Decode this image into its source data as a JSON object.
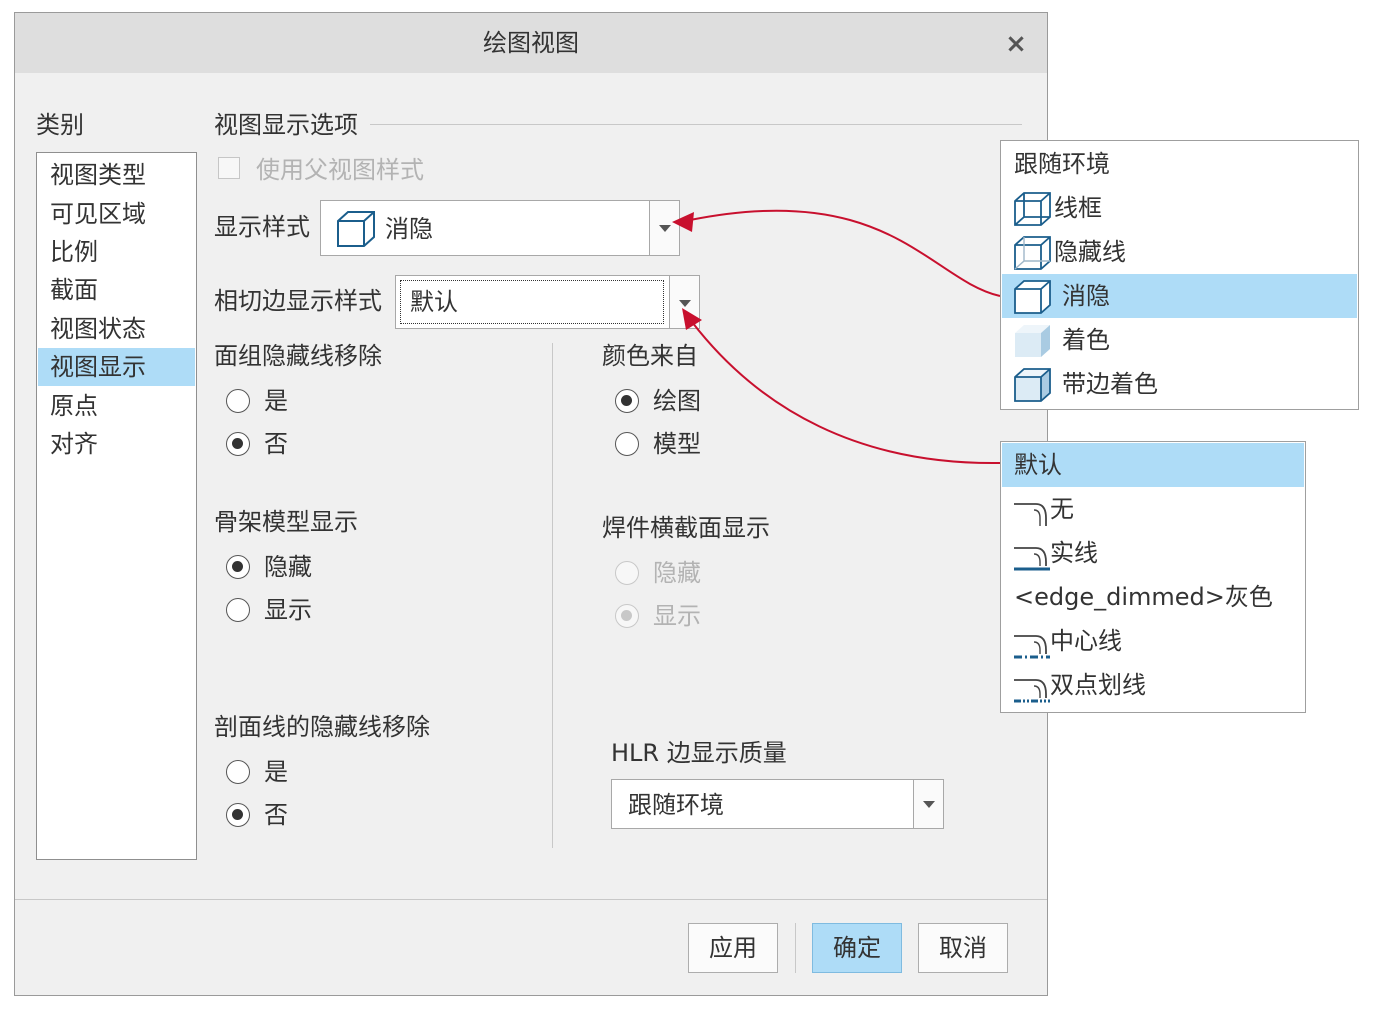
{
  "dialog": {
    "title": "绘图视图",
    "close_glyph": "×",
    "category_label": "类别",
    "categories": [
      "视图类型",
      "可见区域",
      "比例",
      "截面",
      "视图状态",
      "视图显示",
      "原点",
      "对齐"
    ],
    "selected_category": "视图显示",
    "section_title": "视图显示选项",
    "use_parent_style_label": "使用父视图样式",
    "display_style": {
      "label": "显示样式",
      "value": "消隐"
    },
    "tangent_edge": {
      "label": "相切边显示样式",
      "value": "默认"
    },
    "face_group_hlr": {
      "label": "面组隐藏线移除",
      "options": [
        "是",
        "否"
      ],
      "selected": "否"
    },
    "color_from": {
      "label": "颜色来自",
      "options": [
        "绘图",
        "模型"
      ],
      "selected": "绘图"
    },
    "skeleton_display": {
      "label": "骨架模型显示",
      "options": [
        "隐藏",
        "显示"
      ],
      "selected": "隐藏"
    },
    "weld_xsec_display": {
      "label": "焊件横截面显示",
      "options": [
        "隐藏",
        "显示"
      ],
      "selected": "显示",
      "disabled": true
    },
    "xhatch_hlr": {
      "label": "剖面线的隐藏线移除",
      "options": [
        "是",
        "否"
      ],
      "selected": "否"
    },
    "hlr_quality": {
      "label": "HLR 边显示质量",
      "value": "跟随环境"
    },
    "buttons": {
      "apply": "应用",
      "ok": "确定",
      "cancel": "取消"
    }
  },
  "display_style_popup": {
    "items": [
      {
        "label": "跟随环境",
        "icon": "none"
      },
      {
        "label": "线框",
        "icon": "wireframe-cube-icon"
      },
      {
        "label": "隐藏线",
        "icon": "hidden-line-cube-icon"
      },
      {
        "label": "消隐",
        "icon": "no-hidden-cube-icon"
      },
      {
        "label": "着色",
        "icon": "shaded-cube-icon"
      },
      {
        "label": "带边着色",
        "icon": "shaded-edges-cube-icon"
      }
    ],
    "selected": "消隐"
  },
  "tangent_popup": {
    "items": [
      {
        "label": "默认",
        "icon": "none"
      },
      {
        "label": "无",
        "icon": "tangent-none-icon"
      },
      {
        "label": "实线",
        "icon": "tangent-solid-icon"
      },
      {
        "label": "<edge_dimmed>灰色",
        "icon": "none"
      },
      {
        "label": "中心线",
        "icon": "tangent-centerline-icon"
      },
      {
        "label": "双点划线",
        "icon": "tangent-phantom-icon"
      }
    ],
    "selected": "默认"
  },
  "colors": {
    "selection": "#aedcf7",
    "arrow": "#c8102e",
    "dialog_bg": "#f0f0f0",
    "title_bg": "#dedede"
  }
}
